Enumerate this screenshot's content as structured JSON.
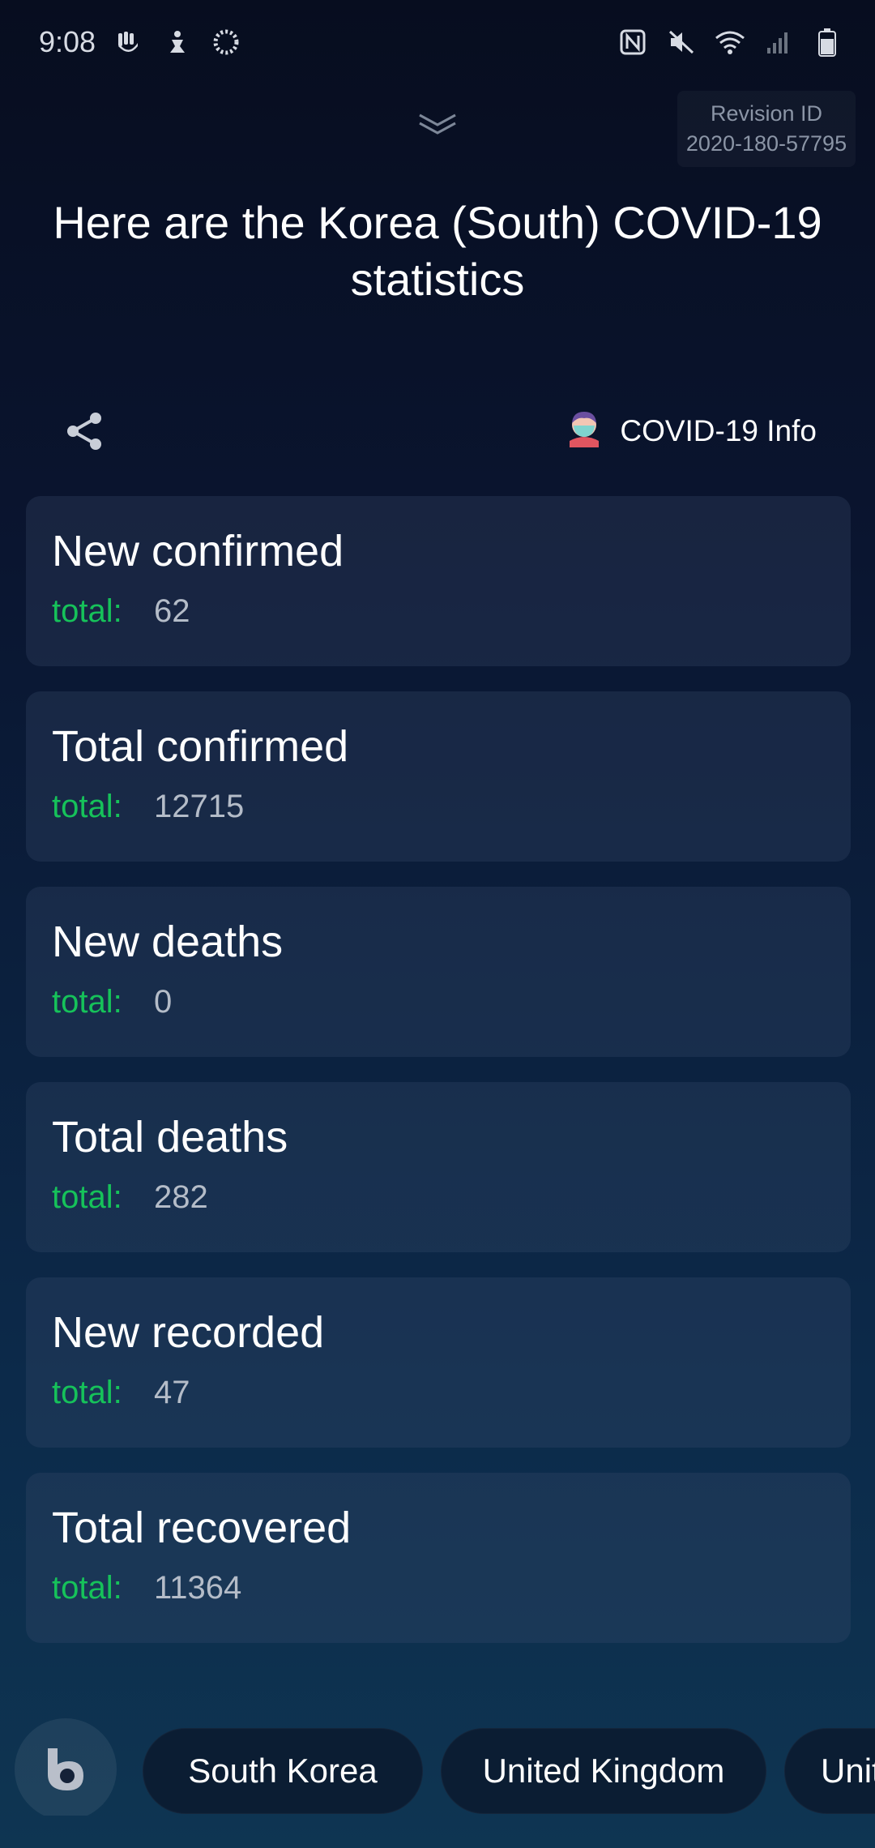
{
  "status_bar": {
    "time": "9:08",
    "left_icons": [
      "gesture-icon",
      "accessibility-icon",
      "loading-icon"
    ],
    "right_icons": [
      "nfc-icon",
      "mute-icon",
      "wifi-icon",
      "signal-icon",
      "battery-icon"
    ]
  },
  "revision": {
    "label": "Revision ID",
    "value": "2020-180-57795"
  },
  "headline": "Here are the Korea (South) COVID-19 statistics",
  "toolbar": {
    "info_label": "COVID-19 Info"
  },
  "stats": [
    {
      "title": "New confirmed",
      "key": "total:",
      "value": "62"
    },
    {
      "title": "Total confirmed",
      "key": "total:",
      "value": "12715"
    },
    {
      "title": "New deaths",
      "key": "total:",
      "value": "0"
    },
    {
      "title": "Total deaths",
      "key": "total:",
      "value": "282"
    },
    {
      "title": "New recorded",
      "key": "total:",
      "value": "47"
    },
    {
      "title": "Total recovered",
      "key": "total:",
      "value": "11364"
    }
  ],
  "suggestions": [
    "South Korea",
    "United Kingdom",
    "Unit"
  ],
  "colors": {
    "accent_green": "#16c25a",
    "value_grey": "#b4bcc8",
    "background_top": "#070d1f",
    "background_bottom": "#0e3552"
  }
}
